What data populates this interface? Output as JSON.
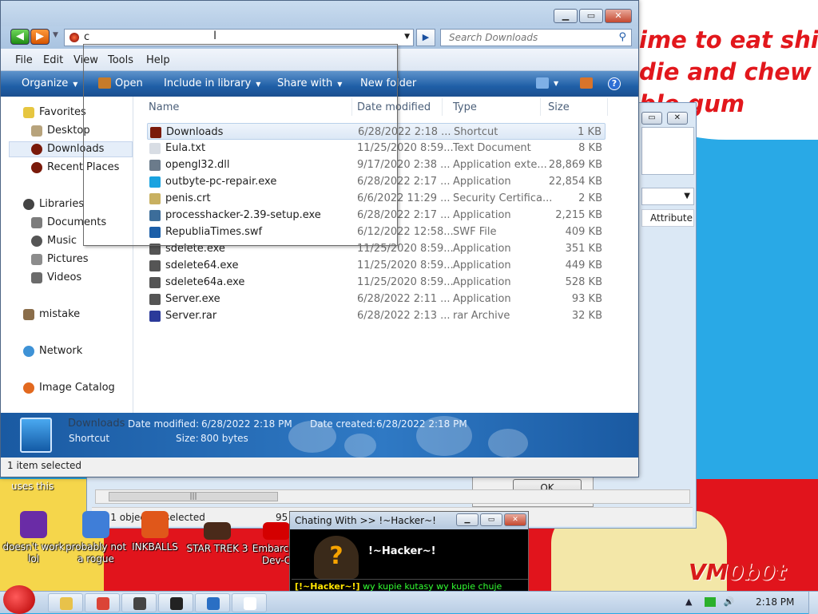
{
  "desktop": {
    "poster_text": "ime to eat shi\ndie and chew\nble gum",
    "signature_text": "VM0b0t",
    "uses_this": "uses this",
    "icons": [
      {
        "label": "doesn't work lol",
        "icon": "yahoo-messenger-icon",
        "color": "#6a2ca6"
      },
      {
        "label": "probably not a rogue",
        "icon": "monitor-icon",
        "color": "#3f7ed8"
      },
      {
        "label": "INKBALLS",
        "icon": "inkball-icon",
        "color": "#e0571a"
      },
      {
        "label": "STAR TREK 3",
        "icon": "star-trek-icon",
        "color": "#4a2a1a"
      },
      {
        "label": "Embarcad Dev-C",
        "icon": "cpp-icon",
        "color": "#d40000"
      }
    ]
  },
  "back_window": {
    "caption_buttons": [
      "▭",
      "✕"
    ],
    "attribute_header": "Attribute",
    "hscroll_thumb": "|||",
    "status_left": "1 / 1 object(s) selected",
    "status_count": "95",
    "ok_label": "OK"
  },
  "window": {
    "caption_buttons": {
      "minimize": "▁",
      "maximize": "▭",
      "close": "✕"
    },
    "address": {
      "text": "c",
      "caret": "I"
    },
    "search": {
      "placeholder": "Search Downloads"
    },
    "menu": [
      "File",
      "Edit",
      "View",
      "Tools",
      "Help"
    ],
    "commands": [
      {
        "label": "Organize",
        "dropdown": true
      },
      {
        "label": "Open",
        "dropdown": false
      },
      {
        "label": "Include in library",
        "dropdown": true
      },
      {
        "label": "Share with",
        "dropdown": true
      },
      {
        "label": "New folder",
        "dropdown": false
      }
    ],
    "nav": {
      "favorites": "Favorites",
      "desktop": "Desktop",
      "downloads": "Downloads",
      "recent": "Recent Places",
      "libraries": "Libraries",
      "documents": "Documents",
      "music": "Music",
      "pictures": "Pictures",
      "videos": "Videos",
      "mistake": "mistake",
      "network": "Network",
      "image_catalog": "Image Catalog"
    },
    "columns": {
      "name": "Name",
      "date": "Date modified",
      "type": "Type",
      "size": "Size"
    },
    "files": [
      {
        "name": "Downloads",
        "date": "6/28/2022 2:18 ...",
        "type": "Shortcut",
        "size": "1 KB",
        "icon": "shortcut-icon",
        "color": "#7a1a0a",
        "selected": true
      },
      {
        "name": "Eula.txt",
        "date": "11/25/2020 8:59...",
        "type": "Text Document",
        "size": "8 KB",
        "icon": "text-file-icon",
        "color": "#d8dde4"
      },
      {
        "name": "opengl32.dll",
        "date": "9/17/2020 2:38 ...",
        "type": "Application exte...",
        "size": "28,869 KB",
        "icon": "dll-icon",
        "color": "#6b7b8b"
      },
      {
        "name": "outbyte-pc-repair.exe",
        "date": "6/28/2022 2:17 ...",
        "type": "Application",
        "size": "22,854 KB",
        "icon": "outbyte-icon",
        "color": "#1aa3e0"
      },
      {
        "name": "penis.crt",
        "date": "6/6/2022 11:29 ...",
        "type": "Security Certifica...",
        "size": "2 KB",
        "icon": "certificate-icon",
        "color": "#c8b060"
      },
      {
        "name": "processhacker-2.39-setup.exe",
        "date": "6/28/2022 2:17 ...",
        "type": "Application",
        "size": "2,215 KB",
        "icon": "installer-icon",
        "color": "#3c6d9a"
      },
      {
        "name": "RepubliaTimes.swf",
        "date": "6/12/2022 12:58...",
        "type": "SWF File",
        "size": "409 KB",
        "icon": "swf-icon",
        "color": "#1b5ea8"
      },
      {
        "name": "sdelete.exe",
        "date": "11/25/2020 8:59...",
        "type": "Application",
        "size": "351 KB",
        "icon": "exe-icon",
        "color": "#555"
      },
      {
        "name": "sdelete64.exe",
        "date": "11/25/2020 8:59...",
        "type": "Application",
        "size": "449 KB",
        "icon": "exe-icon",
        "color": "#555"
      },
      {
        "name": "sdelete64a.exe",
        "date": "11/25/2020 8:59...",
        "type": "Application",
        "size": "528 KB",
        "icon": "exe-icon",
        "color": "#555"
      },
      {
        "name": "Server.exe",
        "date": "6/28/2022 2:11 ...",
        "type": "Application",
        "size": "93 KB",
        "icon": "exe-icon",
        "color": "#555"
      },
      {
        "name": "Server.rar",
        "date": "6/28/2022 2:13 ...",
        "type": "rar Archive",
        "size": "32 KB",
        "icon": "rar-icon",
        "color": "#2b3a9a"
      }
    ],
    "details": {
      "name": "Downloads",
      "modified_label": "Date modified:",
      "modified_value": "6/28/2022 2:18 PM",
      "created_label": "Date created:",
      "created_value": "6/28/2022 2:18 PM",
      "type": "Shortcut",
      "size_label": "Size:",
      "size_value": "800 bytes"
    },
    "status": "1 item selected"
  },
  "chat": {
    "title": "Chating With >> !~Hacker~!",
    "name": "!~Hacker~!",
    "avatar": "?",
    "message_from": "[!~Hacker~!]",
    "message_text": "wy kupie kutasy wy kupie chuje"
  },
  "taskbar": {
    "clock": "2:18 PM",
    "buttons": [
      {
        "icon": "folder-icon",
        "color": "#e8c24a"
      },
      {
        "icon": "chrome-icon",
        "color": "#db4437"
      },
      {
        "icon": "network-globe-icon",
        "color": "#444"
      },
      {
        "icon": "7zip-icon",
        "color": "#222"
      },
      {
        "icon": "book-icon",
        "color": "#2a6fc4"
      },
      {
        "icon": "window-icon",
        "color": "#fff"
      }
    ]
  }
}
